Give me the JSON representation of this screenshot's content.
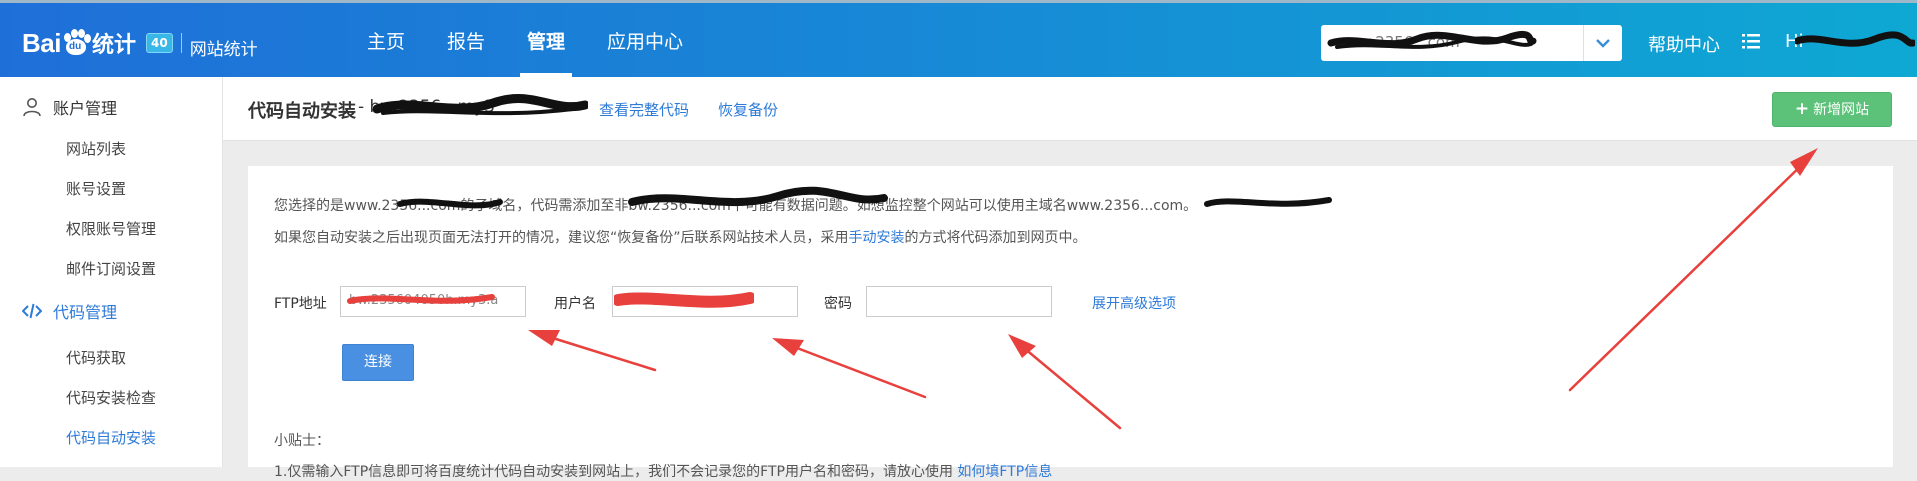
{
  "header": {
    "logo_text": "Bai",
    "logo_paw_text": "du",
    "logo_tongji": "统计",
    "logo_badge": "40",
    "logo_site": "网站统计",
    "nav": [
      {
        "label": "主页"
      },
      {
        "label": "报告"
      },
      {
        "label": "管理"
      },
      {
        "label": "应用中心"
      }
    ],
    "active_nav": "管理",
    "site_select_value": "www.2356...com",
    "help_label": "帮助中心",
    "greeting": "Hi"
  },
  "sidebar": {
    "account_group": "账户管理",
    "account_items": [
      {
        "label": "网站列表"
      },
      {
        "label": "账号设置"
      },
      {
        "label": "权限账号管理"
      },
      {
        "label": "邮件订阅设置"
      }
    ],
    "code_group": "代码管理",
    "code_items": [
      {
        "label": "代码获取"
      },
      {
        "label": "代码安装检查"
      },
      {
        "label": "代码自动安装"
      }
    ],
    "active_item": "代码自动安装"
  },
  "pagehead": {
    "title": "代码自动安装",
    "site": "- bw.2356...my3",
    "view_code_link": "查看完整代码",
    "restore_link": "恢复备份",
    "add_site_button": "新增网站"
  },
  "content": {
    "notice_line1": "您选择的是www.2356...com的子域名，代码需添加至非bw.2356...com下可能有数据问题。如想监控整个网站可以使用主域名www.2356...com。",
    "notice_line2_a": "如果您自动安装之后出现页面无法打开的情况，建议您“恢复备份”后联系网站技术人员，采用",
    "notice_line2_link": "手动安装",
    "notice_line2_b": "的方式将代码添加到网页中。",
    "ftp_label": "FTP地址",
    "ftp_value": "bw.235604050h.my3.a",
    "user_label": "用户名",
    "user_value": "",
    "password_label": "密码",
    "password_value": "",
    "advanced_link": "展开高级选项",
    "connect_button": "连接",
    "tips_title": "小贴士：",
    "tips_line_a": "1.仅需输入FTP信息即可将百度统计代码自动安装到网站上，我们不会记录您的FTP用户名和密码，请放心使用",
    "tips_line_link": "如何填FTP信息"
  },
  "colors": {
    "header_start": "#1f6fd8",
    "header_end": "#0ea8d3",
    "link": "#2d7ad8",
    "add_button": "#5cc27a",
    "connect_button": "#4a90e2",
    "annotation_arrow": "#e8403c"
  },
  "icons": {
    "user": "user-icon",
    "code": "code-icon",
    "list": "list-icon",
    "caret": "chevron-down-icon",
    "plus": "plus-icon"
  }
}
